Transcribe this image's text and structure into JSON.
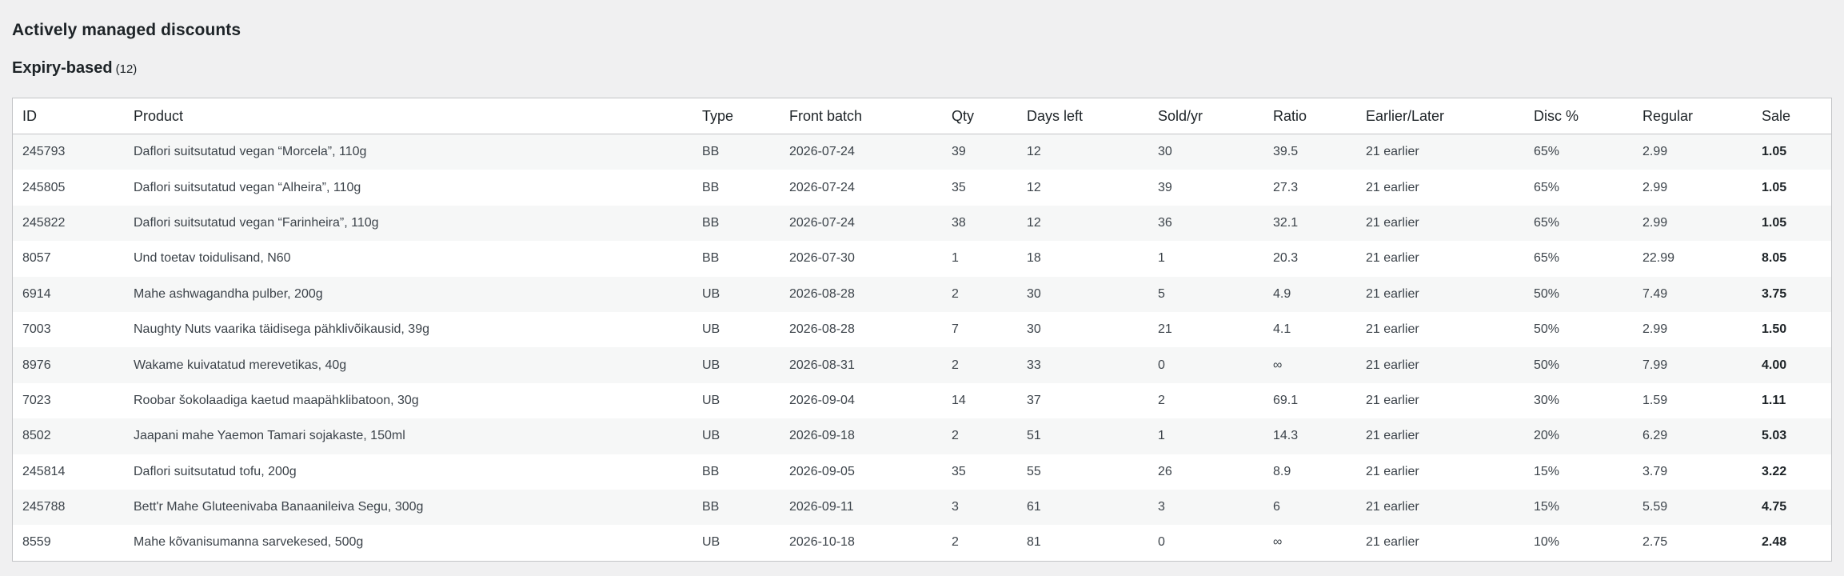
{
  "section": {
    "title": "Actively managed discounts",
    "subtitle": "Expiry-based",
    "count": "(12)"
  },
  "table": {
    "headers": [
      "ID",
      "Product",
      "Type",
      "Front batch",
      "Qty",
      "Days left",
      "Sold/yr",
      "Ratio",
      "Earlier/Later",
      "Disc %",
      "Regular",
      "Sale"
    ],
    "rows": [
      [
        "245793",
        "Daflori suitsutatud vegan “Morcela”, 110g",
        "BB",
        "2026-07-24",
        "39",
        "12",
        "30",
        "39.5",
        "21 earlier",
        "65%",
        "2.99",
        "1.05"
      ],
      [
        "245805",
        "Daflori suitsutatud vegan “Alheira”, 110g",
        "BB",
        "2026-07-24",
        "35",
        "12",
        "39",
        "27.3",
        "21 earlier",
        "65%",
        "2.99",
        "1.05"
      ],
      [
        "245822",
        "Daflori suitsutatud vegan “Farinheira”, 110g",
        "BB",
        "2026-07-24",
        "38",
        "12",
        "36",
        "32.1",
        "21 earlier",
        "65%",
        "2.99",
        "1.05"
      ],
      [
        "8057",
        "Und toetav toidulisand, N60",
        "BB",
        "2026-07-30",
        "1",
        "18",
        "1",
        "20.3",
        "21 earlier",
        "65%",
        "22.99",
        "8.05"
      ],
      [
        "6914",
        "Mahe ashwagandha pulber, 200g",
        "UB",
        "2026-08-28",
        "2",
        "30",
        "5",
        "4.9",
        "21 earlier",
        "50%",
        "7.49",
        "3.75"
      ],
      [
        "7003",
        "Naughty Nuts vaarika täidisega pähklivõikausid, 39g",
        "UB",
        "2026-08-28",
        "7",
        "30",
        "21",
        "4.1",
        "21 earlier",
        "50%",
        "2.99",
        "1.50"
      ],
      [
        "8976",
        "Wakame kuivatatud merevetikas, 40g",
        "UB",
        "2026-08-31",
        "2",
        "33",
        "0",
        "∞",
        "21 earlier",
        "50%",
        "7.99",
        "4.00"
      ],
      [
        "7023",
        "Roobar šokolaadiga kaetud maapähklibatoon, 30g",
        "UB",
        "2026-09-04",
        "14",
        "37",
        "2",
        "69.1",
        "21 earlier",
        "30%",
        "1.59",
        "1.11"
      ],
      [
        "8502",
        "Jaapani mahe Yaemon Tamari sojakaste, 150ml",
        "UB",
        "2026-09-18",
        "2",
        "51",
        "1",
        "14.3",
        "21 earlier",
        "20%",
        "6.29",
        "5.03"
      ],
      [
        "245814",
        "Daflori suitsutatud tofu, 200g",
        "BB",
        "2026-09-05",
        "35",
        "55",
        "26",
        "8.9",
        "21 earlier",
        "15%",
        "3.79",
        "3.22"
      ],
      [
        "245788",
        "Bett'r Mahe Gluteenivaba Banaanileiva Segu, 300g",
        "BB",
        "2026-09-11",
        "3",
        "61",
        "3",
        "6",
        "21 earlier",
        "15%",
        "5.59",
        "4.75"
      ],
      [
        "8559",
        "Mahe kõvanisumanna sarvekesed, 500g",
        "UB",
        "2026-10-18",
        "2",
        "81",
        "0",
        "∞",
        "21 earlier",
        "10%",
        "2.75",
        "2.48"
      ]
    ]
  }
}
